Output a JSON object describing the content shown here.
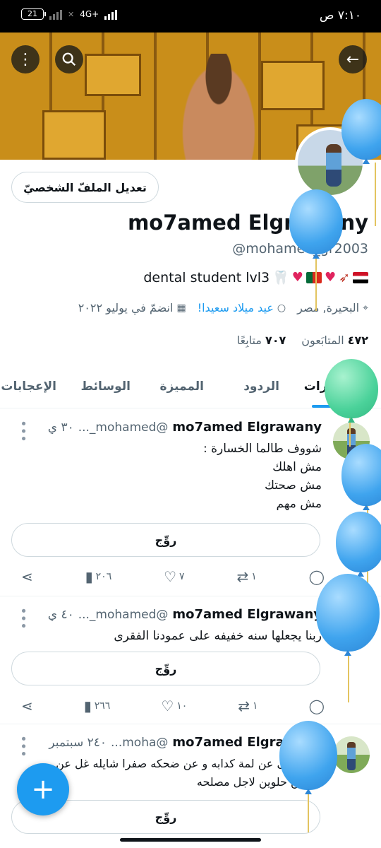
{
  "status_bar": {
    "time": "٧:١٠ ص",
    "battery": "21",
    "network": "4G+"
  },
  "icons": {
    "back": "arrow-left-icon",
    "search": "search-icon",
    "more": "more-vertical-icon"
  },
  "profile": {
    "edit_button": "تعديل الملفّ الشخصيّ",
    "name": "mo7amed Elgrawany",
    "handle": "@mohamed_gr2003",
    "bio_text": "dental student lvl3",
    "location": "البحيرة, مصر",
    "birthday": "عيد ميلاد سعيدا!",
    "joined": "انضمّ في يوليو ٢٠٢٢",
    "following_count": "٤٧٢",
    "following_label": "المتابَعون",
    "followers_count": "٧٠٧",
    "followers_label": "متابِعًا"
  },
  "tabs": [
    {
      "label": "المنشورات",
      "active": true
    },
    {
      "label": "الردود",
      "active": false
    },
    {
      "label": "المميزة",
      "active": false
    },
    {
      "label": "الوسائط",
      "active": false
    },
    {
      "label": "الإعجابات",
      "active": false
    }
  ],
  "tweets": [
    {
      "name": "mo7amed Elgrawany",
      "handle": "@mohamed_...",
      "time": "٣٠ ي",
      "body": "شووف طالما الخسارة :\nمش اهلك\nمش صحتك\nمش مهم",
      "translate": "روِّج",
      "replies": "",
      "retweets": "١",
      "likes": "٧",
      "views": "٢٠٦"
    },
    {
      "name": "mo7amed Elgrawany",
      "handle": "@mohamed_...",
      "time": "٤٠ ي",
      "body": "ربنا يجعلها سنه خفيفه على عمودنا الفقرى",
      "translate": "روِّج",
      "replies": "",
      "retweets": "١",
      "likes": "١٠",
      "views": "٢٦٦"
    },
    {
      "name": "mo7amed Elgrawany",
      "handle": "@moha...",
      "time": "٢٤٠ سبتمبر",
      "body": "الله الغنى عن لمة كدابه و عن ضحكه صفرا شايله غل عن\nكلمتين حلوين لاجل مصلحه",
      "translate": "روِّج"
    }
  ],
  "colors": {
    "accent": "#1d9bf0",
    "text": "#0f1419",
    "muted": "#536471"
  }
}
